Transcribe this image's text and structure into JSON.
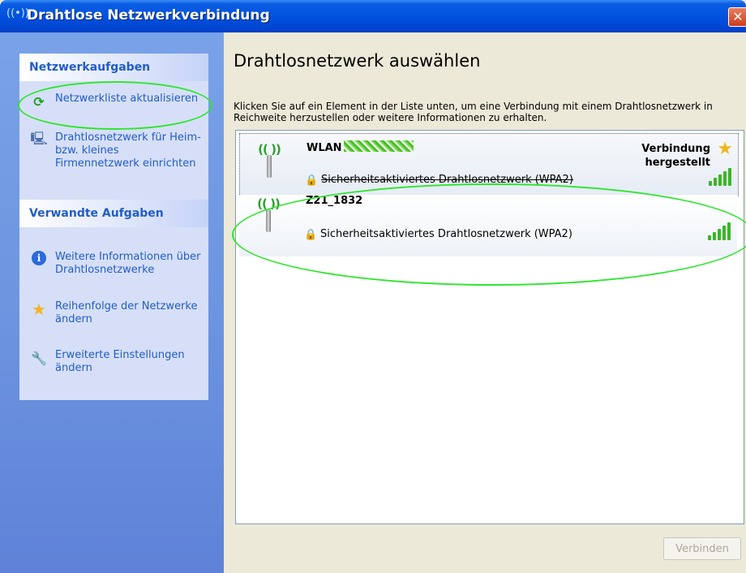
{
  "window": {
    "title": "Drahtlose Netzwerkverbindung",
    "title_icon": "((὏6))",
    "close_glyph": "✕"
  },
  "sidebar": {
    "network_tasks": {
      "header": "Netzwerkaufgaben",
      "items": [
        {
          "label": "Netzwerkliste aktualisieren",
          "icon": "refresh-icon"
        },
        {
          "label": "Drahtlosnetzwerk für Heim- bzw. kleines Firmennetzwerk einrichten",
          "icon": "wizard-icon"
        }
      ]
    },
    "related_tasks": {
      "header": "Verwandte Aufgaben",
      "items": [
        {
          "label": "Weitere Informationen über Drahtlosnetzwerke",
          "icon": "info-icon"
        },
        {
          "label": "Reihenfolge der Netzwerke ändern",
          "icon": "star-icon"
        },
        {
          "label": "Erweiterte Einstellungen ändern",
          "icon": "wrench-icon"
        }
      ]
    }
  },
  "main": {
    "title": "Drahtlosnetzwerk auswählen",
    "instructions": "Klicken Sie auf ein Element in der Liste unten, um eine Verbindung mit einem Drahtlosnetzwerk in Reichweite herzustellen oder weitere Informationen zu erhalten.",
    "networks": [
      {
        "name": "WLAN",
        "status_line1": "Verbindung",
        "status_line2": "hergestellt",
        "security": "Sicherheitsaktiviertes Drahtlosnetzwerk (WPA2)",
        "signal_bars": 5
      },
      {
        "name": "Z21_1832",
        "security": "Sicherheitsaktiviertes Drahtlosnetzwerk (WPA2)",
        "signal_bars": 5
      }
    ],
    "connect_button": "Verbinden"
  },
  "colors": {
    "titlebar": "#0050de",
    "sidebar": "#6d95e0",
    "link": "#215dc6",
    "annotation": "#2fe52f",
    "signal": "#3bb52a"
  }
}
